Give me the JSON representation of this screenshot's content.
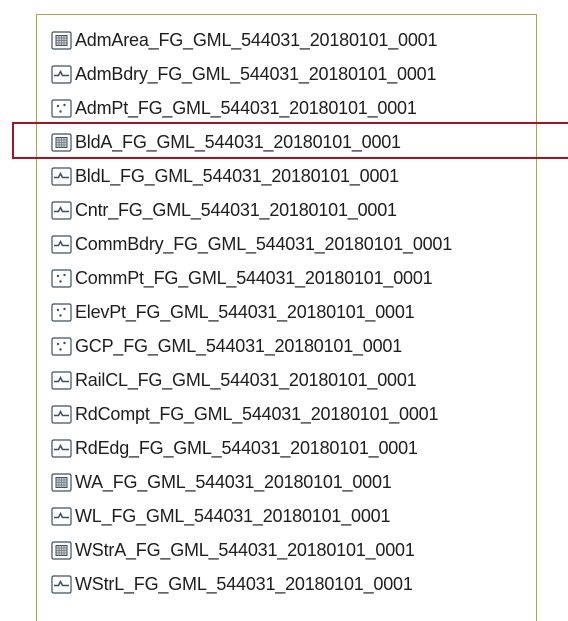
{
  "layers": [
    {
      "label": "AdmArea_FG_GML_544031_20180101_0001",
      "geometry": "polygon"
    },
    {
      "label": "AdmBdry_FG_GML_544031_20180101_0001",
      "geometry": "line"
    },
    {
      "label": "AdmPt_FG_GML_544031_20180101_0001",
      "geometry": "point"
    },
    {
      "label": "BldA_FG_GML_544031_20180101_0001",
      "geometry": "polygon"
    },
    {
      "label": "BldL_FG_GML_544031_20180101_0001",
      "geometry": "line"
    },
    {
      "label": "Cntr_FG_GML_544031_20180101_0001",
      "geometry": "line"
    },
    {
      "label": "CommBdry_FG_GML_544031_20180101_0001",
      "geometry": "line"
    },
    {
      "label": "CommPt_FG_GML_544031_20180101_0001",
      "geometry": "point"
    },
    {
      "label": "ElevPt_FG_GML_544031_20180101_0001",
      "geometry": "point"
    },
    {
      "label": "GCP_FG_GML_544031_20180101_0001",
      "geometry": "point"
    },
    {
      "label": "RailCL_FG_GML_544031_20180101_0001",
      "geometry": "line"
    },
    {
      "label": "RdCompt_FG_GML_544031_20180101_0001",
      "geometry": "line"
    },
    {
      "label": "RdEdg_FG_GML_544031_20180101_0001",
      "geometry": "line"
    },
    {
      "label": "WA_FG_GML_544031_20180101_0001",
      "geometry": "polygon"
    },
    {
      "label": "WL_FG_GML_544031_20180101_0001",
      "geometry": "line"
    },
    {
      "label": "WStrA_FG_GML_544031_20180101_0001",
      "geometry": "polygon"
    },
    {
      "label": "WStrL_FG_GML_544031_20180101_0001",
      "geometry": "line"
    }
  ],
  "icons": {
    "polygon": "polygon-layer-icon",
    "line": "line-layer-icon",
    "point": "point-layer-icon"
  },
  "colors": {
    "panel_border": "#b0a24a",
    "highlight": "#a31621",
    "icon_stroke": "#3d4f63"
  }
}
